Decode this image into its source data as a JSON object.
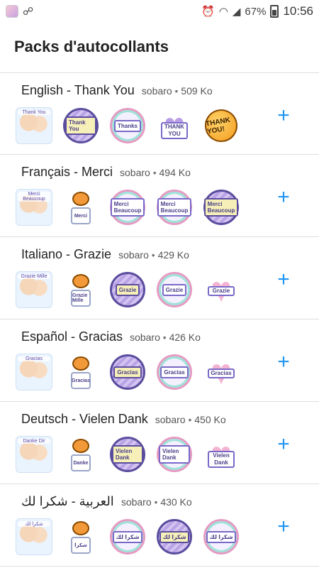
{
  "status_bar": {
    "battery_percent": "67%",
    "time": "10:56",
    "icons": [
      "avatar-icon",
      "link-icon",
      "alarm-icon",
      "wifi-icon",
      "signal-icon",
      "battery-charging-icon"
    ]
  },
  "app": {
    "title": "Packs d'autocollants"
  },
  "accent_color": "#2196f3",
  "add_symbol": "+",
  "meta_separator": "•",
  "packs": [
    {
      "name": "English - Thank You",
      "author": "sobaro",
      "size": "509 Ko",
      "stickers": [
        {
          "kind": "couple",
          "text": "Thank You"
        },
        {
          "kind": "circle",
          "text": "Thank You"
        },
        {
          "kind": "pastel",
          "text": "Thanks"
        },
        {
          "kind": "heart",
          "text": "THANK YOU"
        },
        {
          "kind": "bubble",
          "text": "THANK YOU!"
        }
      ]
    },
    {
      "name": "Français - Merci",
      "author": "sobaro",
      "size": "494 Ko",
      "stickers": [
        {
          "kind": "couple",
          "text": "Merci Beaucoup"
        },
        {
          "kind": "cat",
          "text": "Merci"
        },
        {
          "kind": "pastel",
          "text": "Merci Beaucoup"
        },
        {
          "kind": "pastel",
          "text": "Merci Beaucoup"
        },
        {
          "kind": "circle",
          "text": "Merci Beaucoup"
        }
      ]
    },
    {
      "name": "Italiano - Grazie",
      "author": "sobaro",
      "size": "429 Ko",
      "stickers": [
        {
          "kind": "couple",
          "text": "Grazie Mille"
        },
        {
          "kind": "cat",
          "text": "Grazie Mille"
        },
        {
          "kind": "circle",
          "text": "Grazie"
        },
        {
          "kind": "pastel",
          "text": "Grazie"
        },
        {
          "kind": "heart-pink",
          "text": "Grazie"
        }
      ]
    },
    {
      "name": "Español - Gracias",
      "author": "sobaro",
      "size": "426 Ko",
      "stickers": [
        {
          "kind": "couple",
          "text": "Gracias"
        },
        {
          "kind": "cat",
          "text": "Gracias"
        },
        {
          "kind": "circle",
          "text": "Gracias"
        },
        {
          "kind": "pastel",
          "text": "Gracias"
        },
        {
          "kind": "heart-pink",
          "text": "Gracias"
        }
      ]
    },
    {
      "name": "Deutsch - Vielen Dank",
      "author": "sobaro",
      "size": "450 Ko",
      "stickers": [
        {
          "kind": "couple",
          "text": "Danke Dir"
        },
        {
          "kind": "cat",
          "text": "Danke"
        },
        {
          "kind": "circle",
          "text": "Vielen Dank"
        },
        {
          "kind": "pastel",
          "text": "Vielen Dank"
        },
        {
          "kind": "heart-pink",
          "text": "Vielen Dank"
        }
      ]
    },
    {
      "name": "العربية - شكرا لك",
      "author": "sobaro",
      "size": "430 Ko",
      "stickers": [
        {
          "kind": "couple",
          "text": "شكرا لك"
        },
        {
          "kind": "cat",
          "text": "شكرا"
        },
        {
          "kind": "pastel",
          "text": "شكرا لك"
        },
        {
          "kind": "circle",
          "text": "شكرا لك"
        },
        {
          "kind": "pastel",
          "text": "شكرا لك"
        }
      ]
    }
  ]
}
